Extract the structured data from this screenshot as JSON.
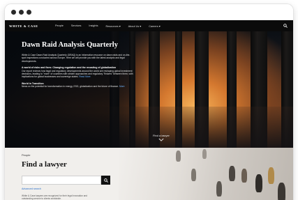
{
  "nav": {
    "logo": "WHITE & CASE",
    "items": [
      {
        "label": "People"
      },
      {
        "label": "Services"
      },
      {
        "label": "Insights"
      },
      {
        "label": "Resources ▾"
      },
      {
        "label": "About Us ▾"
      },
      {
        "label": "Careers ▾"
      }
    ]
  },
  "hero": {
    "title": "Dawn Raid Analysis Quarterly",
    "intro": "White & Case Dawn Raid Analysis Quarterly (DRAQ) is an information resource on dawn raids and on-the-spot inspections conducted across Europe. Here we will provide you with the latest analysis and legal developments.",
    "article1_title": "A world of risks and fixes: Changing regulation and the recasting of globalization",
    "article1_body": "Our report reviews how legal and regulatory developments around the world are reshaping global investment decisions, leading to \"more\" of countries with stricter approaches and regulatory \"fixtures\" between them, with implications for global businesses and sovereign states.",
    "article1_link": "Read More",
    "article2_title": "World in Transition",
    "article2_body": "News on the potential for transformation in energy, ESG, globalization and the future of finance.",
    "article2_link": "More",
    "cta": "Find a lawyer"
  },
  "lawyer": {
    "section": "People",
    "title": "Find a lawyer",
    "search_placeholder": "",
    "advanced": "Advanced search",
    "note": "White & Case lawyers are recognized for their legal innovation and outstanding service to clients worldwide."
  }
}
